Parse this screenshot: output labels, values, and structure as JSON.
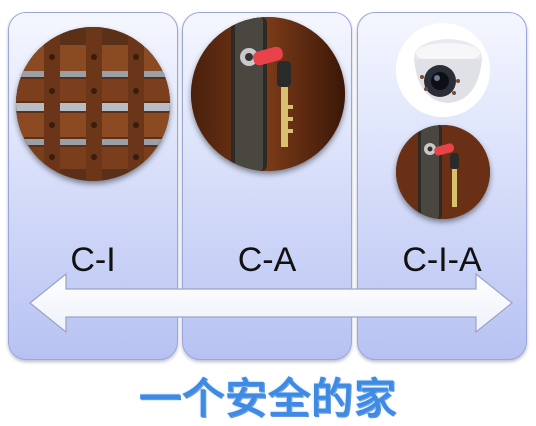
{
  "panels": [
    {
      "label": "C-I",
      "image": "wooden-plank-fence-image"
    },
    {
      "label": "C-A",
      "image": "door-lock-with-key-image"
    },
    {
      "label": "C-I-A",
      "images": [
        "security-camera-image",
        "door-lock-with-key-image"
      ]
    }
  ],
  "arrow": {
    "direction": "bidirectional",
    "color": "#ffffff"
  },
  "footer": {
    "text": "一个安全的家"
  },
  "colors": {
    "panel_top": "#f5f7ff",
    "panel_bottom": "#b7c2f2",
    "footer_text": "#3d8be4"
  }
}
